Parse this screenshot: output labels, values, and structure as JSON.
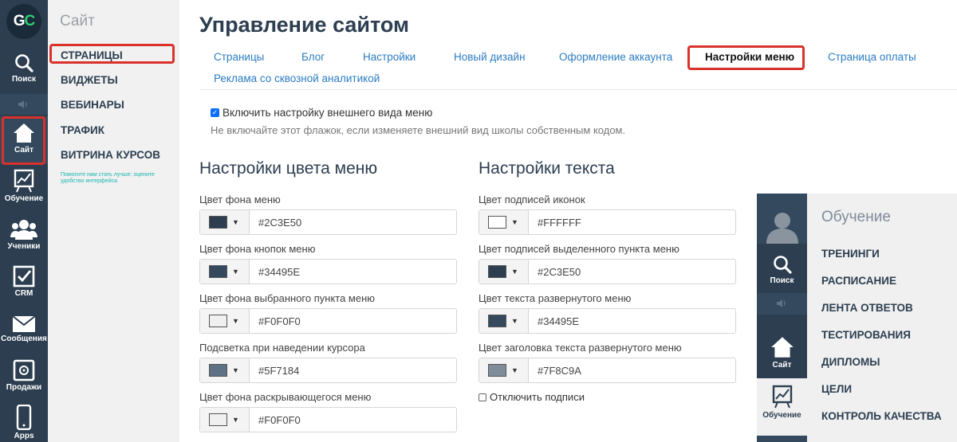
{
  "logo": {
    "g": "G",
    "c": "C"
  },
  "iconbar": {
    "items": [
      {
        "label": "Поиск"
      },
      {
        "label": "Сайт"
      },
      {
        "label": "Обучение"
      },
      {
        "label": "Ученики"
      },
      {
        "label": "CRM"
      },
      {
        "label": "Сообщения"
      },
      {
        "label": "Продажи"
      },
      {
        "label": "Apps"
      }
    ]
  },
  "sitebar": {
    "title": "Сайт",
    "items": [
      "СТРАНИЦЫ",
      "ВИДЖЕТЫ",
      "ВЕБИНАРЫ",
      "ТРАФИК",
      "ВИТРИНА КУРСОВ"
    ],
    "note": "Помогите нам стать лучше: оцените удобство интерфейса"
  },
  "main": {
    "title": "Управление сайтом",
    "tabs": [
      "Страницы",
      "Блог",
      "Настройки",
      "Новый дизайн",
      "Оформление аккаунта",
      "Настройки меню",
      "Страница оплаты",
      "Реклама со сквозной аналитикой"
    ],
    "active_tab": "Настройки меню",
    "enable_checkbox": {
      "label": "Включить настройку внешнего вида меню",
      "checked": true
    },
    "hint": "Не включайте этот флажок, если изменяете внешний вид школы собственным кодом."
  },
  "color_settings": {
    "title": "Настройки цвета меню",
    "fields": [
      {
        "label": "Цвет фона меню",
        "value": "#2C3E50",
        "swatch": "#2C3E50"
      },
      {
        "label": "Цвет фона кнопок меню",
        "value": "#34495E",
        "swatch": "#34495E"
      },
      {
        "label": "Цвет фона выбранного пункта меню",
        "value": "#F0F0F0",
        "swatch": "#F0F0F0"
      },
      {
        "label": "Подсветка при наведении курсора",
        "value": "#5F7184",
        "swatch": "#5F7184"
      },
      {
        "label": "Цвет фона раскрывающегося меню",
        "value": "#F0F0F0",
        "swatch": "#F0F0F0"
      }
    ]
  },
  "text_settings": {
    "title": "Настройки текста",
    "fields": [
      {
        "label": "Цвет подписей иконок",
        "value": "#FFFFFF",
        "swatch": "#FFFFFF"
      },
      {
        "label": "Цвет подписей выделенного пункта меню",
        "value": "#2C3E50",
        "swatch": "#2C3E50"
      },
      {
        "label": "Цвет текста развернутого меню",
        "value": "#34495E",
        "swatch": "#34495E"
      },
      {
        "label": "Цвет заголовка текста развернутого меню",
        "value": "#7F8C9A",
        "swatch": "#7F8C9A"
      }
    ],
    "disable_labels": {
      "label": "Отключить подписи",
      "checked": false
    }
  },
  "preview": {
    "title": "Обучение",
    "icons": [
      "Поиск",
      "Сайт",
      "Обучение"
    ],
    "items": [
      "ТРЕНИНГИ",
      "РАСПИСАНИЕ",
      "ЛЕНТА ОТВЕТОВ",
      "ТЕСТИРОВАНИЯ",
      "ДИПЛОМЫ",
      "ЦЕЛИ",
      "КОНТРОЛЬ КАЧЕСТВА"
    ]
  },
  "colors": {
    "highlight": "#D9312B",
    "link": "#2B7CC2",
    "menu_bg": "#2C3E50"
  }
}
